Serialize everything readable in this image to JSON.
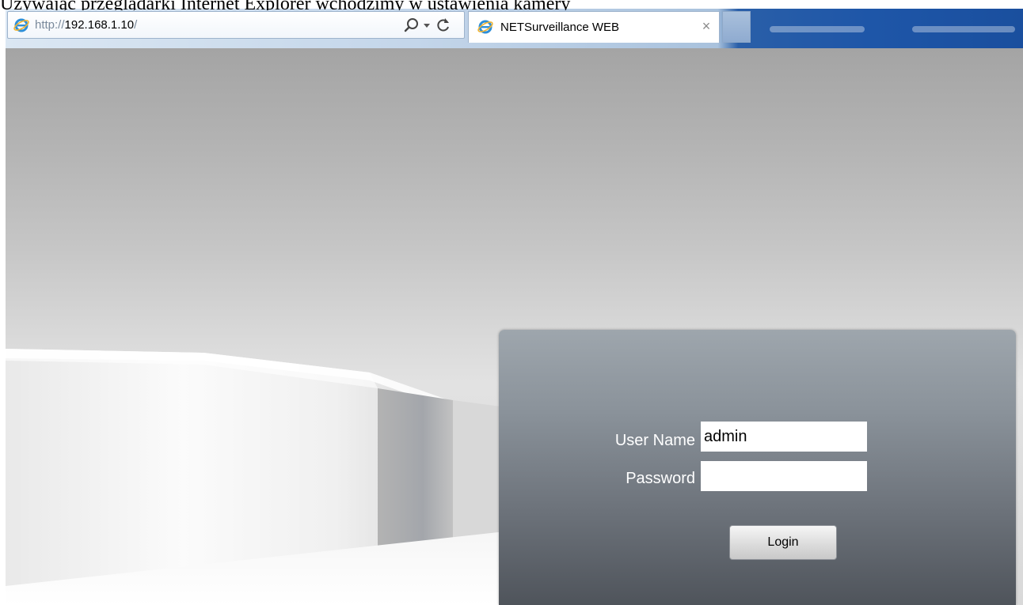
{
  "caption": "Używając przeglądarki Internet Explorer wchodzimy w ustawienia kamery",
  "browser": {
    "address_bar": {
      "url_prefix": "http://",
      "url_host": "192.168.1.10",
      "url_suffix": "/"
    },
    "tab": {
      "title": "NETSurveillance WEB",
      "close_glyph": "×"
    },
    "accent_color": "#1e56a8"
  },
  "login": {
    "username_label": "User Name",
    "username_value": "admin",
    "password_label": "Password",
    "password_value": "",
    "login_button": "Login"
  },
  "icons": [
    "ie-logo-icon",
    "search-icon",
    "dropdown-arrow-icon",
    "refresh-icon",
    "close-icon"
  ]
}
